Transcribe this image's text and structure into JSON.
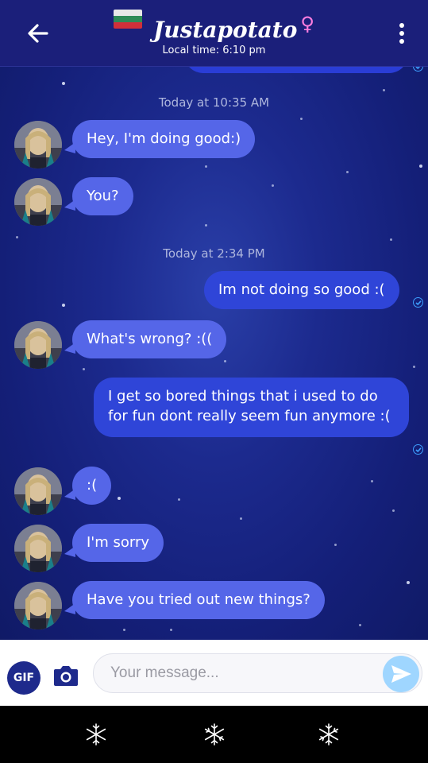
{
  "header": {
    "title": "Justapotato",
    "gender_symbol": "♀",
    "local_time": "Local time: 6:10 pm",
    "flag_colors": [
      "#ffffff",
      "#2e8b57",
      "#d0303a"
    ]
  },
  "colors": {
    "header_bg": "#1b1f7a",
    "incoming_bubble": "#5566e8",
    "outgoing_bubble": "#2f45d8",
    "gif_button": "#1e2a8c",
    "send_button": "#9fd6ff"
  },
  "timestamps": [
    "Today at 10:35 AM",
    "Today at 2:34 PM"
  ],
  "messages": [
    {
      "direction": "in",
      "text": "Hey, I'm doing good:)"
    },
    {
      "direction": "in",
      "text": "You?"
    },
    {
      "direction": "out",
      "text": "Im not doing so good :(",
      "status": "read"
    },
    {
      "direction": "in",
      "text": "What's wrong? :(("
    },
    {
      "direction": "out",
      "text": "I get so bored things that i used to do for fun dont really seem fun anymore :(",
      "status": "read"
    },
    {
      "direction": "in",
      "text": ":("
    },
    {
      "direction": "in",
      "text": "I'm sorry"
    },
    {
      "direction": "in",
      "text": "Have you tried out new things?"
    }
  ],
  "composer": {
    "gif_label": "GIF",
    "placeholder": "Your message...",
    "camera_icon": "camera-icon",
    "send_icon": "send-icon"
  },
  "nav_icons": [
    "snowflake-icon",
    "snowflake-icon",
    "snowflake-icon"
  ]
}
